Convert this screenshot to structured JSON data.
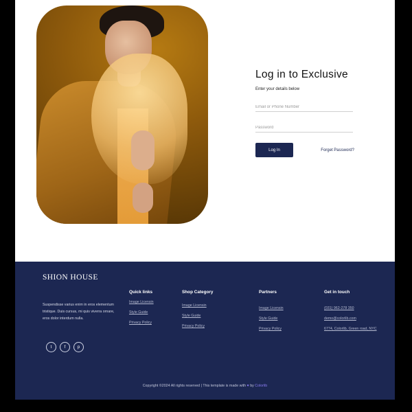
{
  "login": {
    "title": "Log in to Exclusive",
    "subtitle": "Enter your details below",
    "email_placeholder": "Email or Phone Number",
    "password_placeholder": "Password",
    "submit_label": "Log In",
    "forgot_label": "Forget Password?"
  },
  "footer": {
    "brand": "SHION HOUSE",
    "about_lines": [
      "Suspendisse varius enim in eros elementum",
      "tristique. Duis cursus, mi quis viverra ornare,",
      "eros dolor interdum nulla."
    ],
    "socials": [
      {
        "icon": "twitter-icon",
        "glyph": "t"
      },
      {
        "icon": "facebook-icon",
        "glyph": "f"
      },
      {
        "icon": "pinterest-icon",
        "glyph": "p"
      }
    ],
    "quick_links": {
      "heading": "Quick links",
      "items": [
        "Image Licensin",
        "Style Guide",
        "Privacy Policy"
      ]
    },
    "shop_category": {
      "heading": "Shop Category",
      "items": [
        "Image Licensin",
        "Style Guide",
        "Privacy Policy"
      ]
    },
    "partners": {
      "heading": "Partners",
      "items": [
        "Image Licensin",
        "Style Guide",
        "Privacy Policy"
      ]
    },
    "contact": {
      "heading": "Get in touch",
      "items": [
        "(031) 962-278 350",
        "demo@colorlib.com",
        "6774, Colorlib, Green road, NYC"
      ]
    },
    "copyright_prefix": "Copyright ©2024 All rights reserved | This template is made with",
    "copyright_by": "by",
    "copyright_link": "Colorlib"
  },
  "colors": {
    "footer_bg": "#1c2752",
    "button_bg": "#1c2752",
    "heart": "#8a7cf0"
  }
}
